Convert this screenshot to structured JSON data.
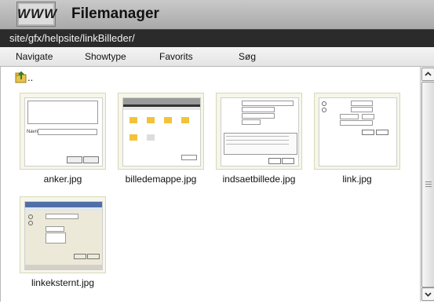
{
  "header": {
    "logo_text": "WWW",
    "title": "Filemanager"
  },
  "path": "site/gfx/helpsite/linkBilleder/",
  "menu": [
    "Navigate",
    "Showtype",
    "Favorits",
    "Søg"
  ],
  "up": {
    "label": "..",
    "icon": "folder-up-icon"
  },
  "files": [
    {
      "name": "anker.jpg"
    },
    {
      "name": "billedemappe.jpg"
    },
    {
      "name": "indsaetbillede.jpg"
    },
    {
      "name": "link.jpg"
    },
    {
      "name": "linkeksternt.jpg"
    }
  ],
  "colors": {
    "titlebar": "#b8b8b8",
    "pathbar": "#2b2b2b",
    "thumb_bg": "#f6f6ea",
    "thumb_border": "#d8d8b8"
  }
}
